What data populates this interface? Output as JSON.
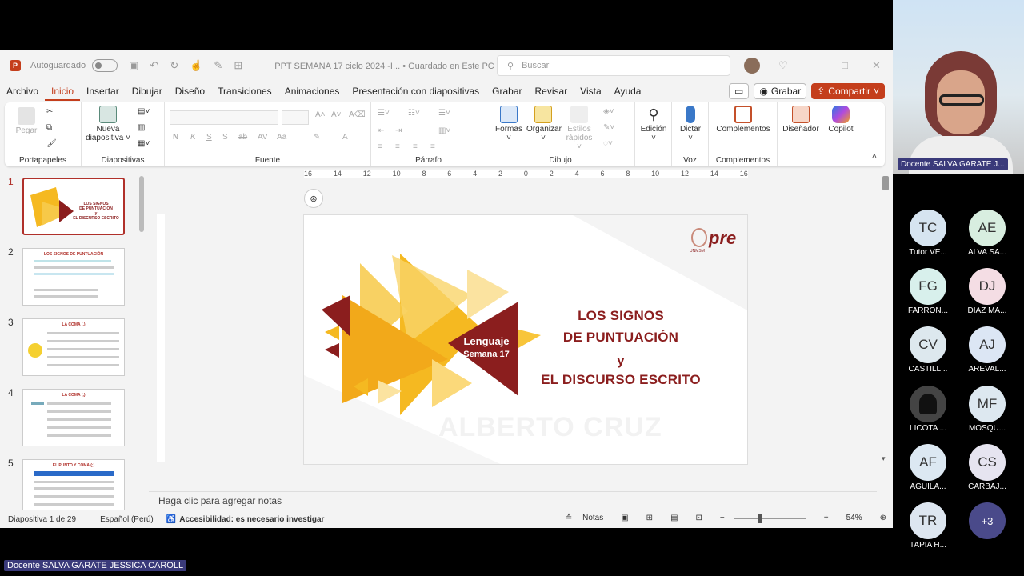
{
  "titlebar": {
    "autosave_label": "Autoguardado",
    "doc_title": "PPT SEMANA 17 ciclo 2024 -I...  •  Guardado en Este PC ⌄",
    "search_placeholder": "Buscar"
  },
  "menu": {
    "items": [
      "Archivo",
      "Inicio",
      "Insertar",
      "Dibujar",
      "Diseño",
      "Transiciones",
      "Animaciones",
      "Presentación con diapositivas",
      "Grabar",
      "Revisar",
      "Vista",
      "Ayuda"
    ],
    "record_label": "Grabar",
    "share_label": "Compartir"
  },
  "ribbon": {
    "groups": {
      "clipboard": "Portapapeles",
      "slides": "Diapositivas",
      "font": "Fuente",
      "paragraph": "Párrafo",
      "drawing": "Dibujo",
      "voice": "Voz",
      "addins": "Complementos"
    },
    "buttons": {
      "paste": "Pegar",
      "new_slide_1": "Nueva",
      "new_slide_2": "diapositiva ˅",
      "shapes": "Formas",
      "arrange": "Organizar",
      "quick_styles_1": "Estilos",
      "quick_styles_2": "rápidos ˅",
      "editing": "Edición",
      "dictate": "Dictar",
      "addins": "Complementos",
      "designer": "Diseñador",
      "copilot": "Copilot"
    }
  },
  "ruler": {
    "top": [
      "16",
      "14",
      "12",
      "10",
      "8",
      "6",
      "4",
      "2",
      "0",
      "2",
      "4",
      "6",
      "8",
      "10",
      "12",
      "14",
      "16"
    ]
  },
  "slides": [
    {
      "num": "1",
      "title": ""
    },
    {
      "num": "2",
      "title": "LOS SIGNOS DE PUNTUACIÓN"
    },
    {
      "num": "3",
      "title": "LA COMA (,)"
    },
    {
      "num": "4",
      "title": "LA COMA (,)"
    },
    {
      "num": "5",
      "title": "EL PUNTO Y COMA (;)"
    }
  ],
  "thumb1": {
    "title_lines": [
      "LOS SIGNOS",
      "DE PUNTUACIÓN",
      "y",
      "EL DISCURSO ESCRITO"
    ]
  },
  "slide": {
    "title_lines": [
      "LOS SIGNOS",
      "DE PUNTUACIÓN",
      "y",
      "EL DISCURSO ESCRITO"
    ],
    "badge_line1": "Lenguaje",
    "badge_line2": "Semana 17",
    "watermark": "ALBERTO CRUZ",
    "logo_text": "pre",
    "logo_sub": "UNMSM",
    "colors": {
      "title": "#8b1e1e",
      "yellow": "#f5b921",
      "dark_red": "#8b1e1e"
    }
  },
  "notes_placeholder": "Haga clic para agregar notas",
  "status": {
    "slide_count": "Diapositiva 1 de 29",
    "language": "Español (Perú)",
    "accessibility": "Accesibilidad: es necesario investigar",
    "notes": "Notas",
    "zoom": "54%"
  },
  "video": {
    "main_name": "Docente SALVA GARATE J...",
    "bottom_name": "Docente SALVA GARATE JESSICA CAROLL",
    "participants": [
      {
        "initials": "TC",
        "name": "Tutor VE...",
        "color": "#d6e4f0"
      },
      {
        "initials": "AE",
        "name": "ALVA SA...",
        "color": "#d8eee0"
      },
      {
        "initials": "FG",
        "name": "FARRON...",
        "color": "#d8f0ec"
      },
      {
        "initials": "DJ",
        "name": "DIAZ MA...",
        "color": "#f4dde4"
      },
      {
        "initials": "CV",
        "name": "CASTILL...",
        "color": "#dde8ee"
      },
      {
        "initials": "AJ",
        "name": "AREVAL...",
        "color": "#dce6f4"
      },
      {
        "initials": "",
        "name": "LICOTA ...",
        "color": "#444444"
      },
      {
        "initials": "MF",
        "name": "MOSQU...",
        "color": "#dde8f0"
      },
      {
        "initials": "AF",
        "name": "AGUILA...",
        "color": "#dce8f2"
      },
      {
        "initials": "CS",
        "name": "CARBAJ...",
        "color": "#e6e4f0"
      },
      {
        "initials": "TR",
        "name": "TAPIA H...",
        "color": "#dde6f0"
      },
      {
        "initials": "+3",
        "name": "",
        "color": "#4a4a8a"
      }
    ]
  }
}
